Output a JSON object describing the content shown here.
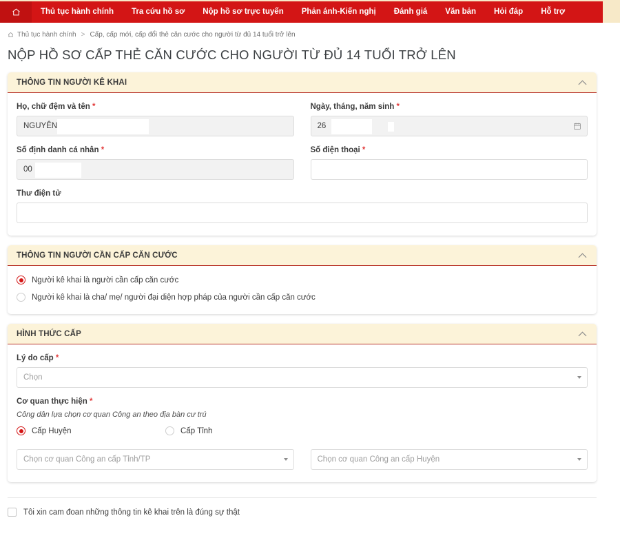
{
  "nav": {
    "home_icon": "home-icon",
    "items": [
      {
        "label": "Thủ tục hành chính"
      },
      {
        "label": "Tra cứu hồ sơ"
      },
      {
        "label": "Nộp hồ sơ trực tuyến"
      },
      {
        "label": "Phản ánh-Kiến nghị"
      },
      {
        "label": "Đánh giá"
      },
      {
        "label": "Văn bản"
      },
      {
        "label": "Hỏi đáp"
      },
      {
        "label": "Hỗ trợ"
      }
    ],
    "bar_color": "#d31515"
  },
  "breadcrumb": {
    "home_icon": "home-icon",
    "root": "Thủ tục hành chính",
    "separator": ">",
    "current": "Cấp, cấp mới, cấp đổi thẻ căn cước cho người từ đủ 14 tuổi trở lên"
  },
  "page": {
    "title": "NỘP HỒ SƠ CẤP THẺ CĂN CƯỚC CHO NGƯỜI TỪ ĐỦ 14 TUỔI TRỞ LÊN",
    "required_marker": "*",
    "header_bg": "#fcf3d9",
    "header_border": "#b9342a"
  },
  "section_declarant": {
    "title": "THÔNG TIN NGƯỜI KÊ KHAI",
    "collapse_icon": "chevron-up-icon",
    "fields": {
      "full_name": {
        "label": "Họ, chữ đệm và tên",
        "required": true,
        "value": "NGUYÊN",
        "placeholder": ""
      },
      "dob": {
        "label": "Ngày, tháng, năm sinh",
        "required": true,
        "value": "26",
        "placeholder": "",
        "icon": "calendar-icon"
      },
      "personal_id": {
        "label": "Số định danh cá nhân",
        "required": true,
        "value": "00",
        "placeholder": ""
      },
      "phone": {
        "label": "Số điện thoại",
        "required": true,
        "value": "",
        "placeholder": ""
      },
      "email": {
        "label": "Thư điện tử",
        "required": false,
        "value": "",
        "placeholder": ""
      }
    }
  },
  "section_subject": {
    "title": "THÔNG TIN NGƯỜI CẦN CẤP CĂN CƯỚC",
    "collapse_icon": "chevron-up-icon",
    "options": [
      {
        "label": "Người kê khai là người cần cấp căn cước",
        "selected": true
      },
      {
        "label": "Người kê khai là cha/ mẹ/ người đại diện hợp pháp của người cần cấp căn cước",
        "selected": false
      }
    ]
  },
  "section_issue": {
    "title": "HÌNH THỨC CẤP",
    "collapse_icon": "chevron-up-icon",
    "reason": {
      "label": "Lý do cấp",
      "required": true,
      "placeholder": "Chọn"
    },
    "agency": {
      "label": "Cơ quan thực hiện",
      "required": true,
      "hint": "Công dân lựa chọn cơ quan Công an theo địa bàn cư trú",
      "levels": [
        {
          "label": "Cấp Huyện",
          "selected": true
        },
        {
          "label": "Cấp Tỉnh",
          "selected": false
        }
      ],
      "province_select": {
        "placeholder": "Chọn cơ quan Công an cấp Tỉnh/TP"
      },
      "district_select": {
        "placeholder": "Chọn cơ quan Công an cấp Huyện"
      }
    }
  },
  "declaration": {
    "label": "Tôi xin cam đoan những thông tin kê khai trên là đúng sự thật",
    "checked": false
  }
}
